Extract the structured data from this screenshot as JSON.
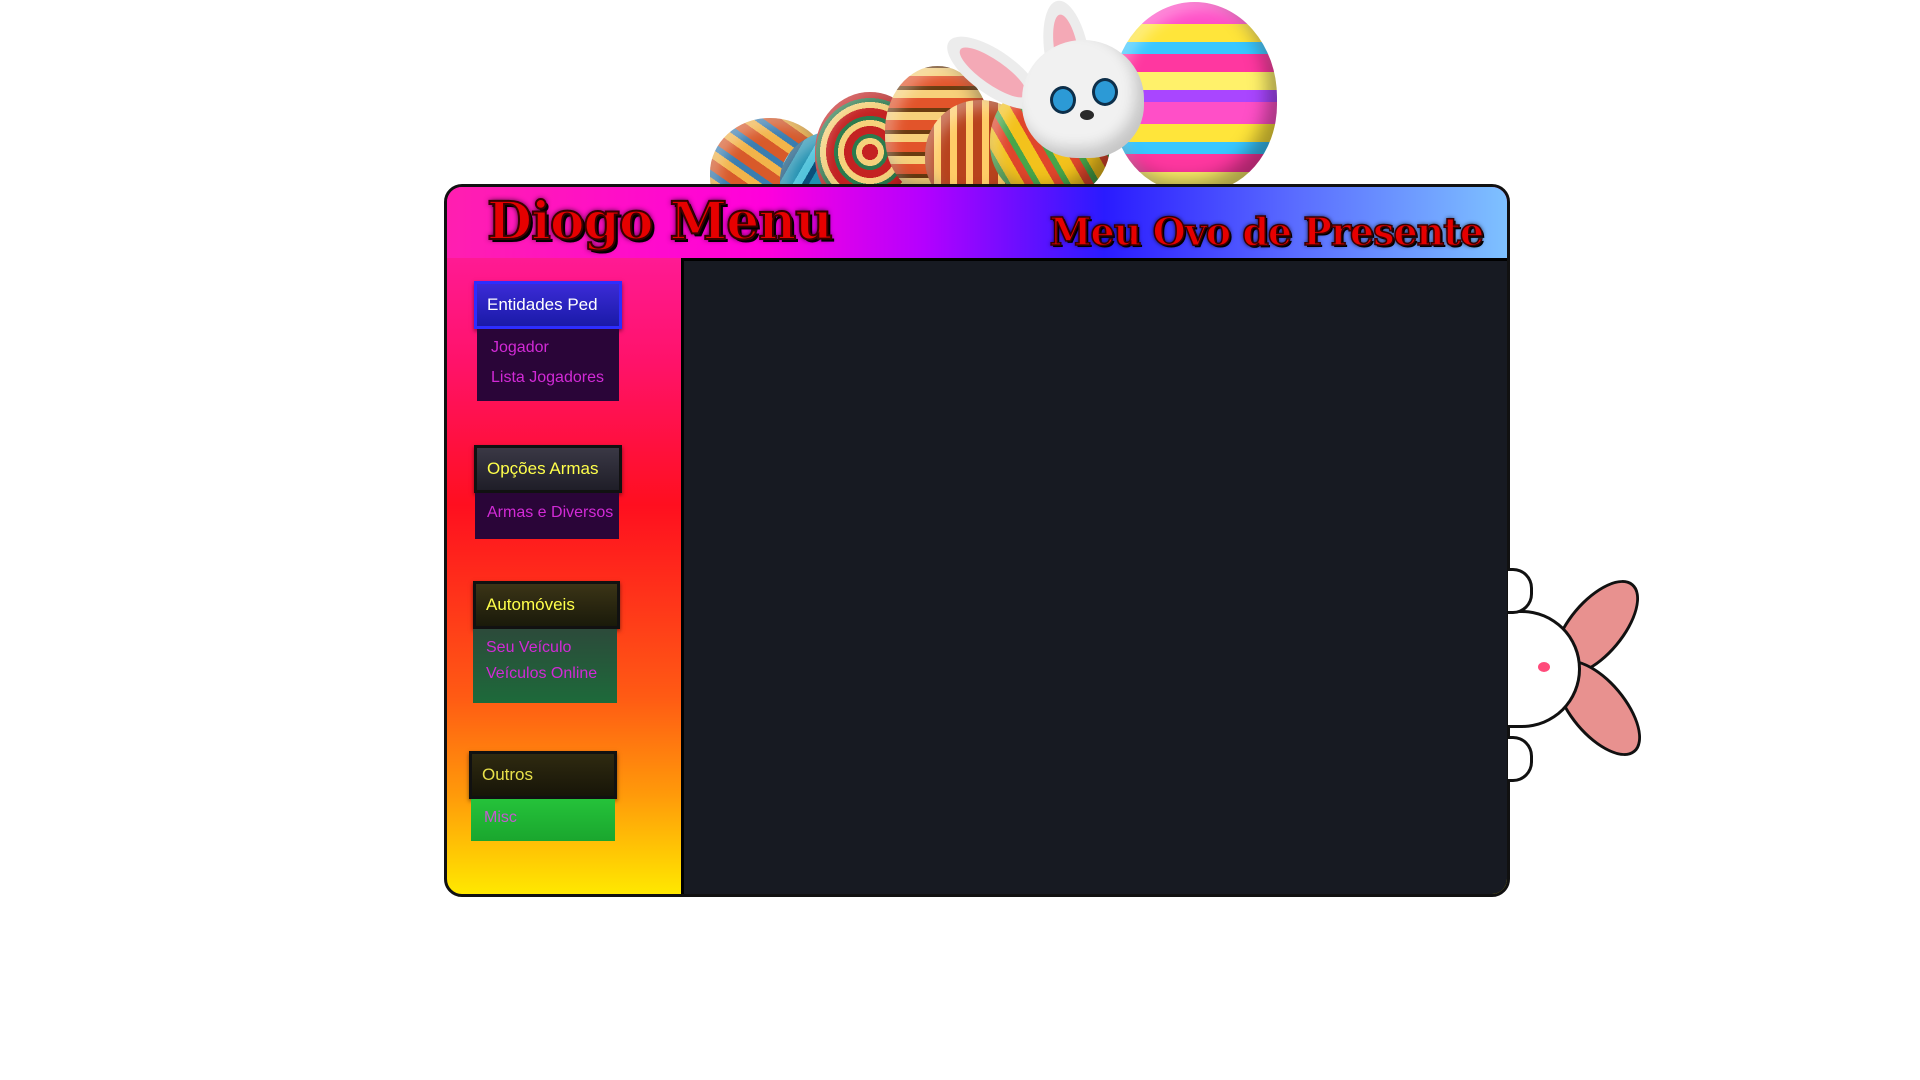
{
  "app": {
    "title": "Diogo Menu",
    "subtitle": "Meu Ovo de Presente"
  },
  "sidebar": {
    "sections": [
      {
        "header": "Entidades Ped",
        "items": [
          "Jogador",
          "Lista Jogadores"
        ]
      },
      {
        "header": "Opções Armas",
        "items": [
          "Armas e Diversos"
        ]
      },
      {
        "header": "Automóveis",
        "items": [
          "Seu Veículo",
          "Veículos Online"
        ]
      },
      {
        "header": "Outros",
        "items": [
          "Misc"
        ]
      }
    ]
  },
  "icons": {
    "top_decoration": "easter-bunny-with-eggs-icon",
    "side_decoration": "peeking-bunny-icon"
  },
  "colors": {
    "title_red": "#e60000",
    "section_header_text": "#ffff4a",
    "item_text": "#d22ad6",
    "content_bg": "#171a22"
  }
}
